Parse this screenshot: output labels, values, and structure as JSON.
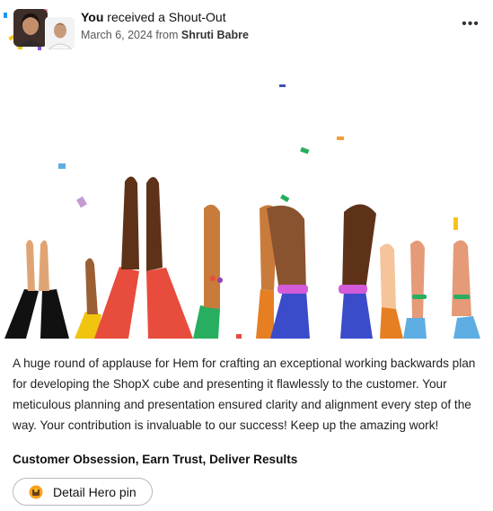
{
  "header": {
    "recipient": "You",
    "action_text": "received a Shout-Out",
    "date": "March 6, 2024",
    "from_word": "from",
    "sender": "Shruti Babre",
    "more_icon": "more-horizontal-icon",
    "more_glyph": "•••"
  },
  "hero": {
    "description_icon": "celebration-illustration"
  },
  "message": {
    "body": "A huge round of applause for Hem for crafting an exceptional working backwards plan for developing the ShopX cube and presenting it flawlessly to the customer. Your meticulous planning and presentation ensured clarity and alignment every step of the way. Your contribution is invaluable to our success! Keep up the amazing work!",
    "values": "Customer Obsession, Earn Trust, Deliver Results"
  },
  "pin_button": {
    "label": "Detail Hero pin",
    "icon": "hero-pin-icon"
  },
  "colors": {
    "accent_orange": "#f7a21b",
    "text_primary": "#0f1111",
    "text_secondary": "#565959"
  }
}
